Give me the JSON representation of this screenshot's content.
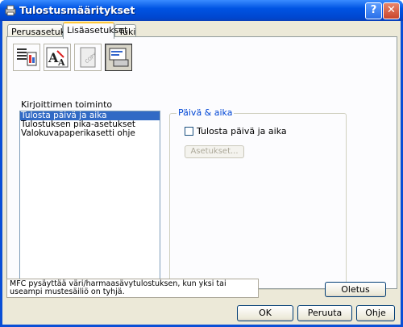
{
  "window": {
    "title": "Tulostusmääritykset",
    "help_label": "?",
    "close_label": "✕"
  },
  "tabs": [
    {
      "label": "Perusasetukset",
      "active": false
    },
    {
      "label": "Lisäasetukset",
      "active": true
    },
    {
      "label": "Tuki",
      "active": false
    }
  ],
  "toolbar_icons": [
    "print-quality-icon",
    "font-scaling-icon",
    "copy-watermark-icon",
    "device-options-icon"
  ],
  "features": {
    "heading": "Kirjoittimen toiminto",
    "items": [
      "Tulosta päivä ja aika",
      "Tulostuksen pika-asetukset",
      "Valokuvapaperikasetti ohje"
    ],
    "selected_index": 0
  },
  "date_time": {
    "group_label": "Päivä & aika",
    "checkbox_label": "Tulosta päivä ja aika",
    "checked": false,
    "settings_button": "Asetukset..."
  },
  "status_text": "MFC pysäyttää väri/harmaasävytulostuksen, kun yksi tai useampi mustesäiliö on tyhjä.",
  "buttons": {
    "default": "Oletus",
    "ok": "OK",
    "cancel": "Peruuta",
    "help": "Ohje"
  }
}
